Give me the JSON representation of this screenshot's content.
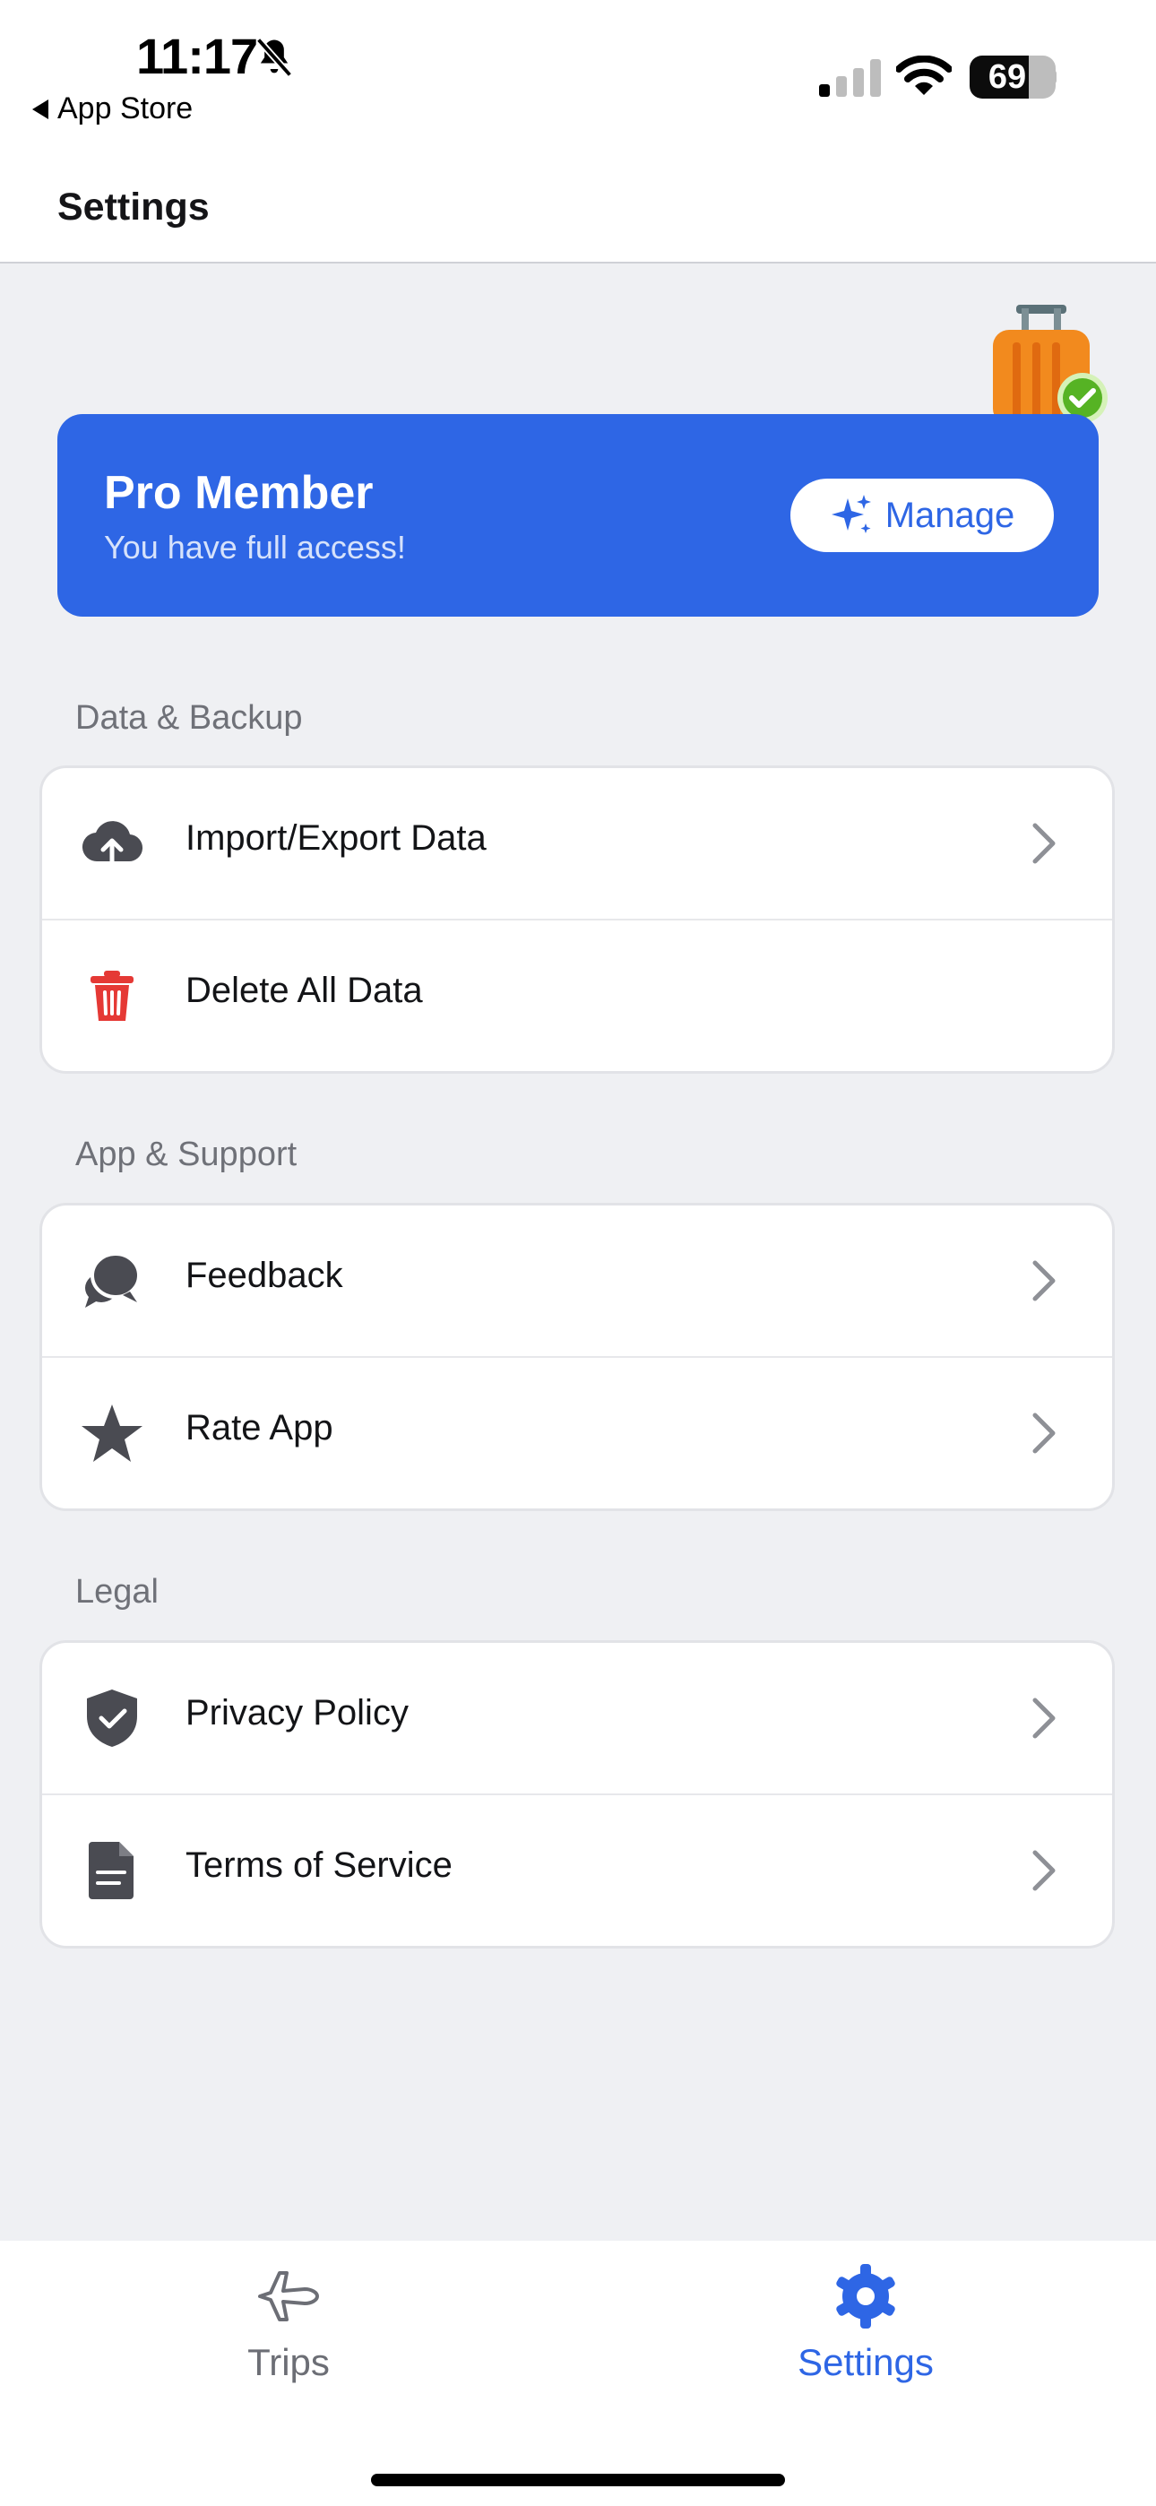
{
  "status_bar": {
    "time": "11:17",
    "back_label": "App Store",
    "battery": "69",
    "icons": [
      "bell-slash-icon",
      "cellular-signal-icon",
      "wifi-icon",
      "battery-icon"
    ]
  },
  "header": {
    "title": "Settings"
  },
  "pro_card": {
    "title": "Pro Member",
    "subtitle": "You have full access!",
    "manage_label": "Manage",
    "manage_icon": "sparkles-icon",
    "illustration": "suitcase-check-icon",
    "color": "#2e66e5"
  },
  "sections": [
    {
      "label": "Data & Backup",
      "items": [
        {
          "label": "Import/Export Data",
          "icon": "cloud-upload-icon",
          "chevron": true
        },
        {
          "label": "Delete All Data",
          "icon": "trash-icon",
          "chevron": false,
          "icon_color": "#e53935"
        }
      ]
    },
    {
      "label": "App & Support",
      "items": [
        {
          "label": "Feedback",
          "icon": "chat-bubbles-icon",
          "chevron": true
        },
        {
          "label": "Rate App",
          "icon": "star-icon",
          "chevron": true
        }
      ]
    },
    {
      "label": "Legal",
      "items": [
        {
          "label": "Privacy Policy",
          "icon": "shield-check-icon",
          "chevron": true
        },
        {
          "label": "Terms of Service",
          "icon": "document-icon",
          "chevron": true
        }
      ]
    }
  ],
  "tab_bar": {
    "tabs": [
      {
        "label": "Trips",
        "icon": "airplane-icon",
        "active": false
      },
      {
        "label": "Settings",
        "icon": "gear-icon",
        "active": true
      }
    ],
    "active_color": "#2e66e5"
  }
}
